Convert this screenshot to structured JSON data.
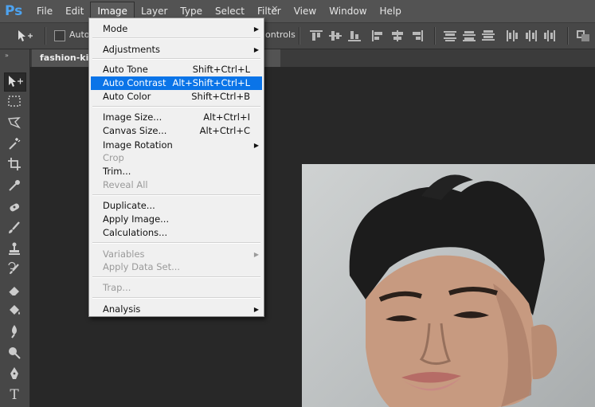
{
  "app": {
    "logo": "Ps"
  },
  "menubar": [
    "File",
    "Edit",
    "Image",
    "Layer",
    "Type",
    "Select",
    "Filter",
    "View",
    "Window",
    "Help"
  ],
  "options_bar": {
    "auto_select_label": "Auto-",
    "controls_label": "ontrols"
  },
  "document": {
    "tab_title": "fashion-king",
    "close_glyph": "×"
  },
  "image_menu": {
    "mode": "Mode",
    "adjustments": "Adjustments",
    "auto_tone": "Auto Tone",
    "auto_tone_sc": "Shift+Ctrl+L",
    "auto_contrast": "Auto Contrast",
    "auto_contrast_sc": "Alt+Shift+Ctrl+L",
    "auto_color": "Auto Color",
    "auto_color_sc": "Shift+Ctrl+B",
    "image_size": "Image Size...",
    "image_size_sc": "Alt+Ctrl+I",
    "canvas_size": "Canvas Size...",
    "canvas_size_sc": "Alt+Ctrl+C",
    "image_rotation": "Image Rotation",
    "crop": "Crop",
    "trim": "Trim...",
    "reveal_all": "Reveal All",
    "duplicate": "Duplicate...",
    "apply_image": "Apply Image...",
    "calculations": "Calculations...",
    "variables": "Variables",
    "apply_data_set": "Apply Data Set...",
    "trap": "Trap...",
    "analysis": "Analysis"
  },
  "colors": {
    "highlight": "#0a74e8",
    "menubar": "#535353",
    "panel": "#474747",
    "workspace": "#282828"
  }
}
